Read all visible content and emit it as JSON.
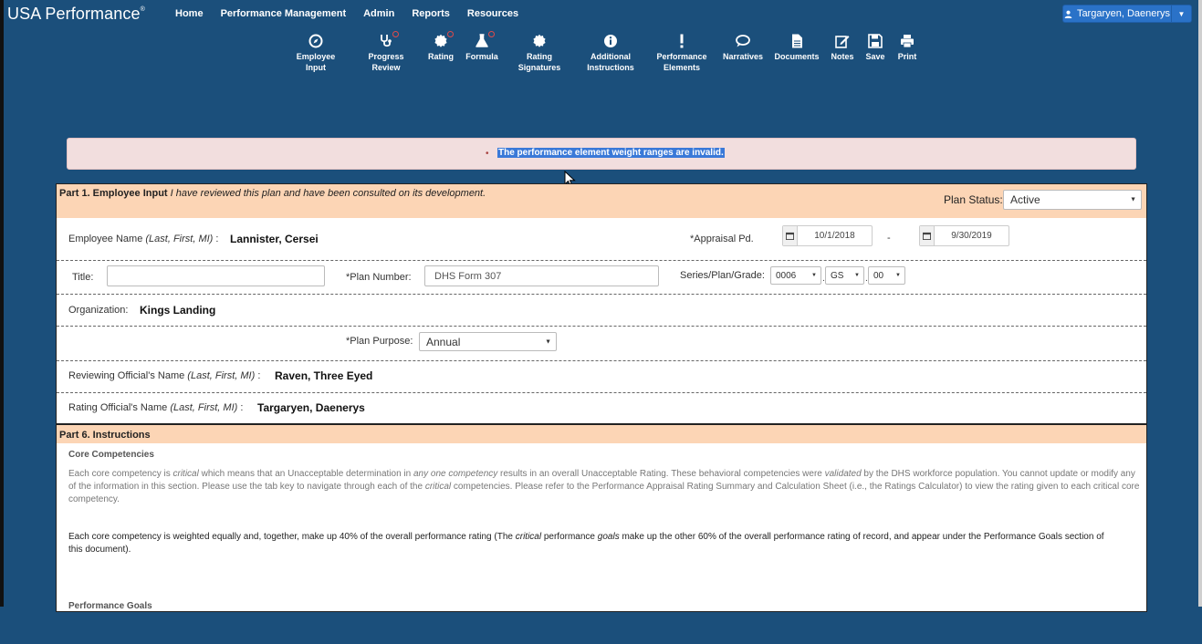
{
  "nav": {
    "brand": "USA Performance",
    "brand_mark": "®",
    "links": [
      "Home",
      "Performance Management",
      "Admin",
      "Reports",
      "Resources"
    ],
    "user": "Targaryen, Daenerys"
  },
  "toolbar": {
    "employee_input": "Employee Input",
    "progress_review_1": "Progress",
    "progress_review_2": "Review",
    "rating": "Rating",
    "formula": "Formula",
    "rating_signatures_1": "Rating",
    "rating_signatures_2": "Signatures",
    "additional_1": "Additional",
    "additional_2": "Instructions",
    "perf_elements_1": "Performance",
    "perf_elements_2": "Elements",
    "narratives": "Narratives",
    "documents": "Documents",
    "notes": "Notes",
    "save": "Save",
    "print": "Print"
  },
  "alert": {
    "bullet": "•",
    "message": "The performance element weight ranges are invalid."
  },
  "part1": {
    "title": "Part 1. Employee Input",
    "subtitle": "I have reviewed this plan and have been consulted on its development.",
    "plan_status_label": "Plan Status:",
    "plan_status_value": "Active",
    "employee_name_label": "Employee Name",
    "name_format": "(Last, First, MI)",
    "colon": ":",
    "employee_name": "Lannister, Cersei",
    "appraisal_label": "*Appraisal Pd.",
    "appraisal_start": "10/1/2018",
    "appraisal_dash": "-",
    "appraisal_end": "9/30/2019",
    "title_label": "Title:",
    "title_value": "",
    "plan_number_label": "*Plan Number:",
    "plan_number_value": "DHS Form 307",
    "series_label": "Series/Plan/Grade:",
    "series_value": "0006",
    "plan_value": "GS",
    "grade_value": "00",
    "dot": ".",
    "organization_label": "Organization:",
    "organization_value": "Kings Landing",
    "plan_purpose_label": "*Plan Purpose:",
    "plan_purpose_value": "Annual",
    "reviewing_label": "Reviewing Official's Name",
    "reviewing_value": "Raven, Three Eyed",
    "rating_official_label": "Rating Official's Name",
    "rating_official_value": "Targaryen, Daenerys"
  },
  "part6": {
    "title": "Part 6. Instructions",
    "core_heading": "Core Competencies",
    "p1_a": "Each core competency is ",
    "p1_critical": "critical",
    "p1_b": " which means that an Unacceptable determination in ",
    "p1_any": "any one competency",
    "p1_c": " results in an overall Unacceptable Rating.   These behavioral competencies were ",
    "p1_validated": "validated",
    "p1_d": " by the DHS workforce population.  You cannot update or modify any of the information in this section.  Please use the tab key to navigate through each of the ",
    "p1_critical2": "critical",
    "p1_e": " competencies.  Please refer to the Performance Appraisal Rating Summary and Calculation Sheet (i.e., the Ratings Calculator) to view the rating given to each critical core competency.",
    "p2_a": "Each core competency is weighted equally and, together, make up 40% of the overall performance rating (The ",
    "p2_critical": "critical",
    "p2_b": " performance ",
    "p2_goals": "goals",
    "p2_c": " make up the other 60% of the overall performance rating of record, and appear under the Performance Goals section of this document).",
    "goals_heading": "Performance Goals"
  },
  "colors": {
    "navbar": "#1b4f7b",
    "section_header": "#fcd5b5",
    "alert_bg": "#f2dede",
    "selection": "#3a79d8",
    "user_button": "#2a72c8"
  }
}
